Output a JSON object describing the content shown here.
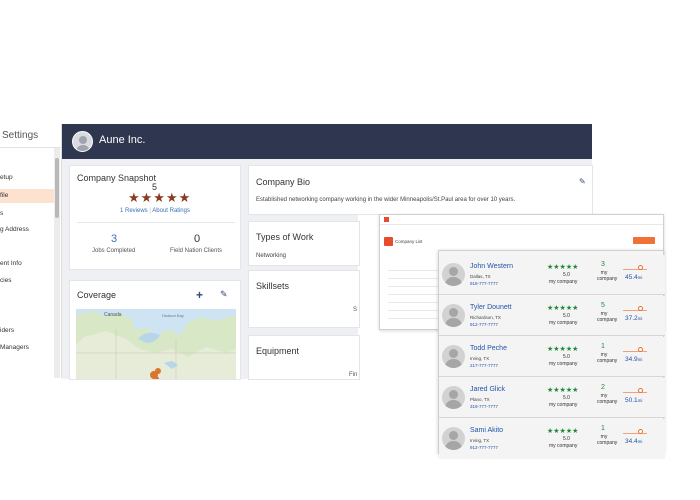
{
  "sidebar": {
    "title": "Settings",
    "items": [
      {
        "label": "etup"
      },
      {
        "label": "file"
      },
      {
        "label": "s"
      },
      {
        "label": "g Address"
      },
      {
        "label": "ent Info"
      },
      {
        "label": "cies"
      },
      {
        "label": "iders"
      },
      {
        "label": "Managers"
      }
    ]
  },
  "company": {
    "name": "Aune Inc."
  },
  "snapshot": {
    "title": "Company Snapshot",
    "rating": "5",
    "stars": "★★★★★",
    "reviews_link": "1 Reviews",
    "about_link": "About Ratings",
    "jobs_completed": "3",
    "jobs_completed_label": "Jobs Completed",
    "field_nation_clients": "0",
    "field_nation_clients_label": "Field Nation Clients"
  },
  "coverage": {
    "title": "Coverage",
    "map_labels": {
      "canada": "Canada",
      "hudson_bay": "Hudson Bay"
    }
  },
  "bio": {
    "title": "Company Bio",
    "text": "Established networking company working in the wider Minneapolis/St.Paul area for over 10 years."
  },
  "types_of_work": {
    "title": "Types of Work",
    "value": "Networking"
  },
  "skillsets": {
    "title": "Skillsets",
    "fragment": "S"
  },
  "equipment": {
    "title": "Equipment",
    "fragment": "Fin"
  },
  "company_list": {
    "title": "Company List"
  },
  "technicians": [
    {
      "name": "John Western",
      "location": "Dallas, TX",
      "phone": "918-777-7777",
      "stars": "★★★★★",
      "score": "5.0",
      "score_label": "my company",
      "count": "3",
      "count_label": "my company",
      "distance": "45.4",
      "unit": "mi"
    },
    {
      "name": "Tyler Dounett",
      "location": "Richardson, TX",
      "phone": "912-777-7777",
      "stars": "★★★★★",
      "score": "5.0",
      "score_label": "my company",
      "count": "5",
      "count_label": "my company",
      "distance": "37.2",
      "unit": "mi"
    },
    {
      "name": "Todd Peche",
      "location": "Irving, TX",
      "phone": "217-777-7777",
      "stars": "★★★★★",
      "score": "5.0",
      "score_label": "my company",
      "count": "1",
      "count_label": "my company",
      "distance": "34.9",
      "unit": "mi"
    },
    {
      "name": "Jared Glick",
      "location": "Plano, TX",
      "phone": "319-777-7777",
      "stars": "★★★★★",
      "score": "5.0",
      "score_label": "my company",
      "count": "2",
      "count_label": "my company",
      "distance": "50.1",
      "unit": "mi"
    },
    {
      "name": "Sami Akito",
      "location": "Irving, TX",
      "phone": "912-777-7777",
      "stars": "★★★★★",
      "score": "5.0",
      "score_label": "my company",
      "count": "1",
      "count_label": "my company",
      "distance": "34.4",
      "unit": "mi"
    }
  ],
  "colors": {
    "header": "#2e3650",
    "accent": "#8a3a1e",
    "link": "#3a70b4",
    "rating_green": "#1f8a3a",
    "orange": "#f07136"
  }
}
